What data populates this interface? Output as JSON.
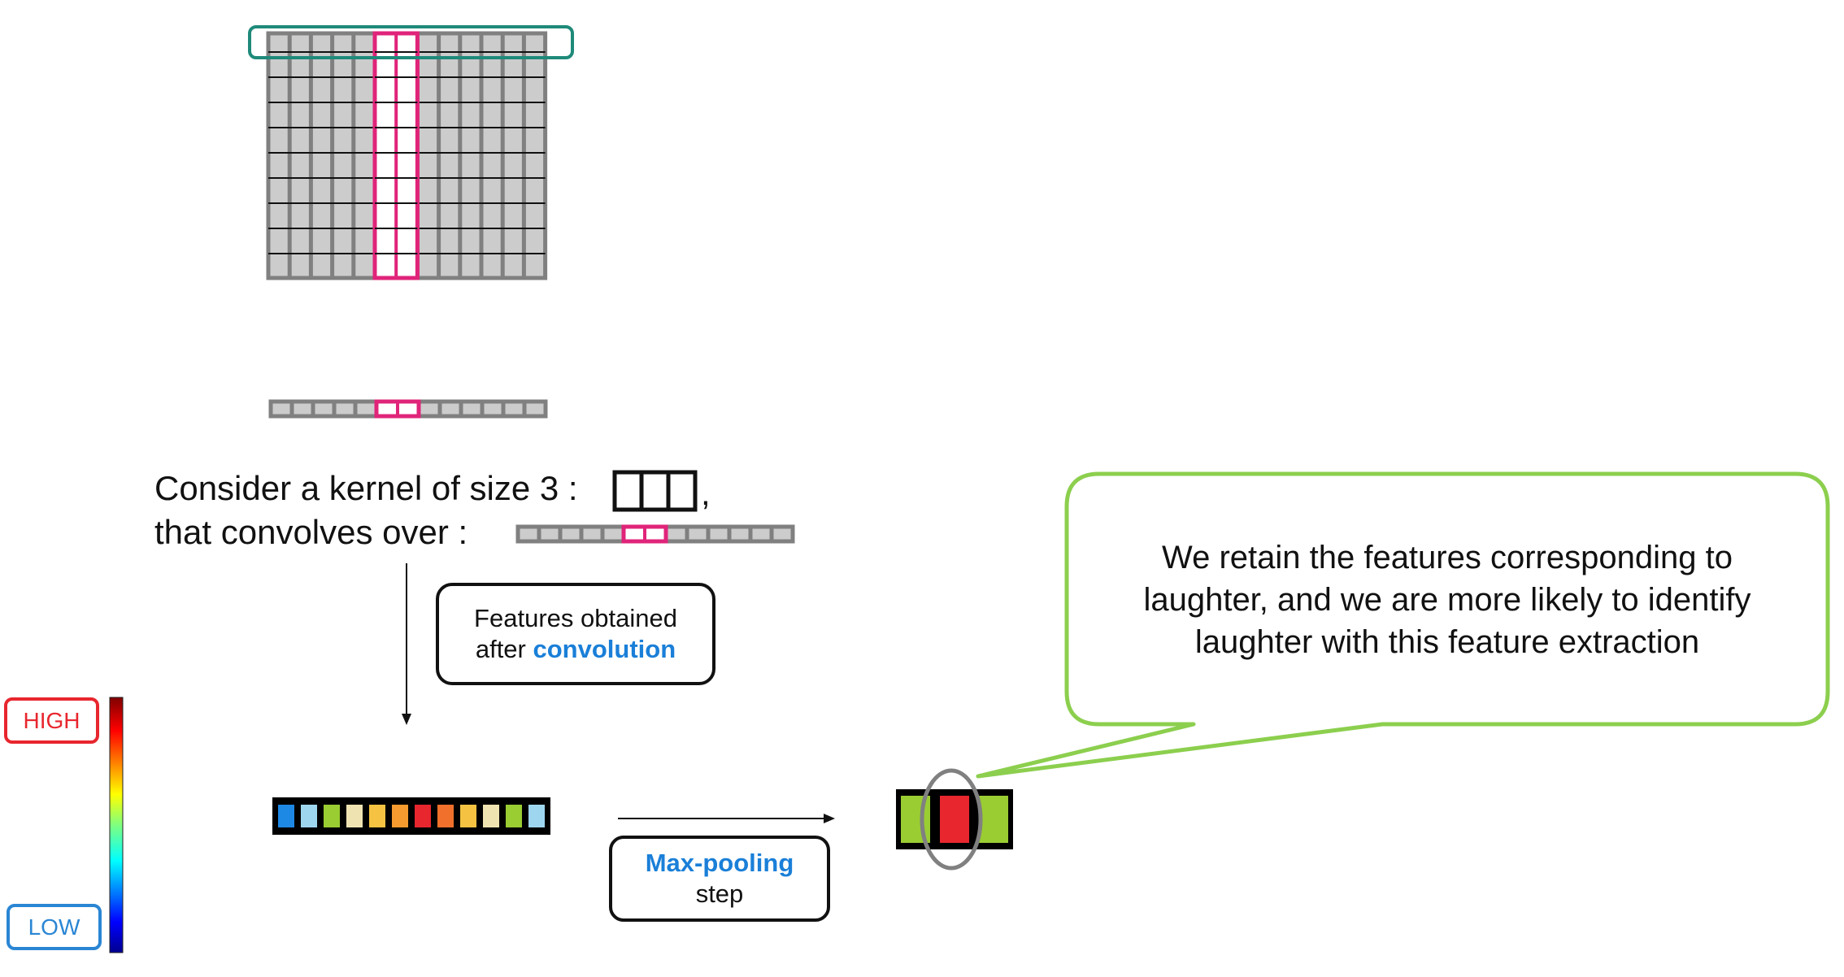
{
  "kernel_text": {
    "line1": "Consider a kernel of size 3 :",
    "line2": "that  convolves over  :",
    "comma": ","
  },
  "conv_box": {
    "line1": "Features obtained",
    "line2_prefix": "after ",
    "line2_accent": "convolution"
  },
  "pool_box": {
    "line1_accent": "Max-pooling",
    "line2": "step"
  },
  "bubble": {
    "text": "We retain the features corresponding to laughter, and we are more likely to identify laughter with this feature extraction"
  },
  "legend": {
    "high": "HIGH",
    "low": "LOW"
  },
  "colors": {
    "magenta": "#e0247a",
    "teal": "#1f8a7a",
    "grid_fill": "#cccccc",
    "grid_stroke": "#808080",
    "accent_blue": "#1a7fd8",
    "bubble_green": "#8ccf4e",
    "high_red": "#e8262e",
    "low_blue": "#2a86d4"
  },
  "feature_vector_colors": [
    "#1e88e5",
    "#9fd6ef",
    "#9acd32",
    "#efe3b2",
    "#f5c242",
    "#f59a2e",
    "#e8262e",
    "#f0702c",
    "#f5c242",
    "#efe3b2",
    "#9acd32",
    "#9fd6ef"
  ],
  "pooled_colors": [
    "#9acd32",
    "#e8262e",
    "#9acd32"
  ]
}
